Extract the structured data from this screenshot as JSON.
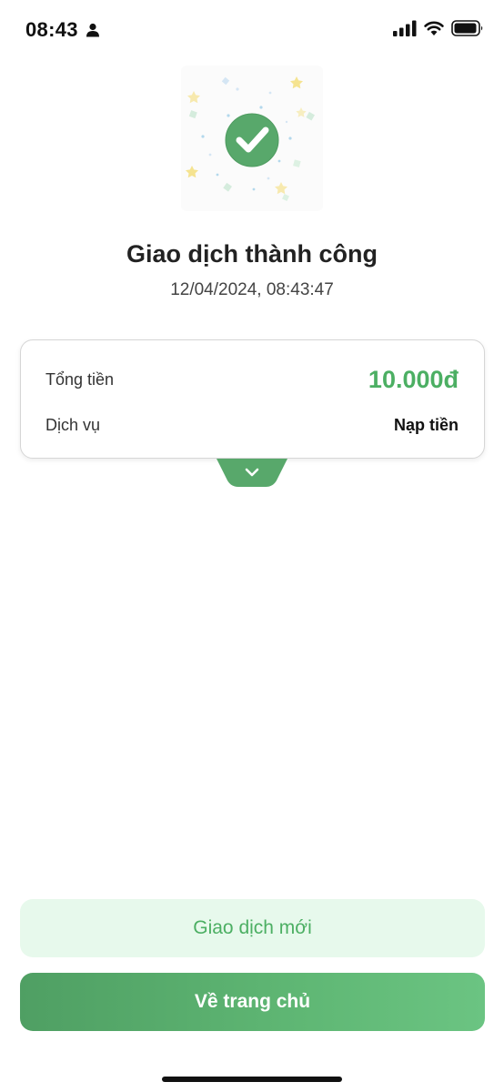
{
  "status_bar": {
    "time": "08:43",
    "icons": [
      "person-icon",
      "signal-icon",
      "wifi-icon",
      "battery-icon"
    ]
  },
  "result": {
    "title": "Giao dịch thành công",
    "datetime": "12/04/2024, 08:43:47",
    "icon": "check-circle-icon"
  },
  "details": {
    "total_label": "Tổng tiền",
    "total_value": "10.000đ",
    "service_label": "Dịch vụ",
    "service_value": "Nạp tiền",
    "expand_icon": "chevron-down-icon"
  },
  "actions": {
    "new_transaction_label": "Giao dịch mới",
    "home_label": "Về trang chủ"
  },
  "colors": {
    "accent": "#4caf63",
    "accent_light": "#e7f9ec",
    "home_gradient_start": "#4f9f63",
    "home_gradient_end": "#6bc482"
  }
}
